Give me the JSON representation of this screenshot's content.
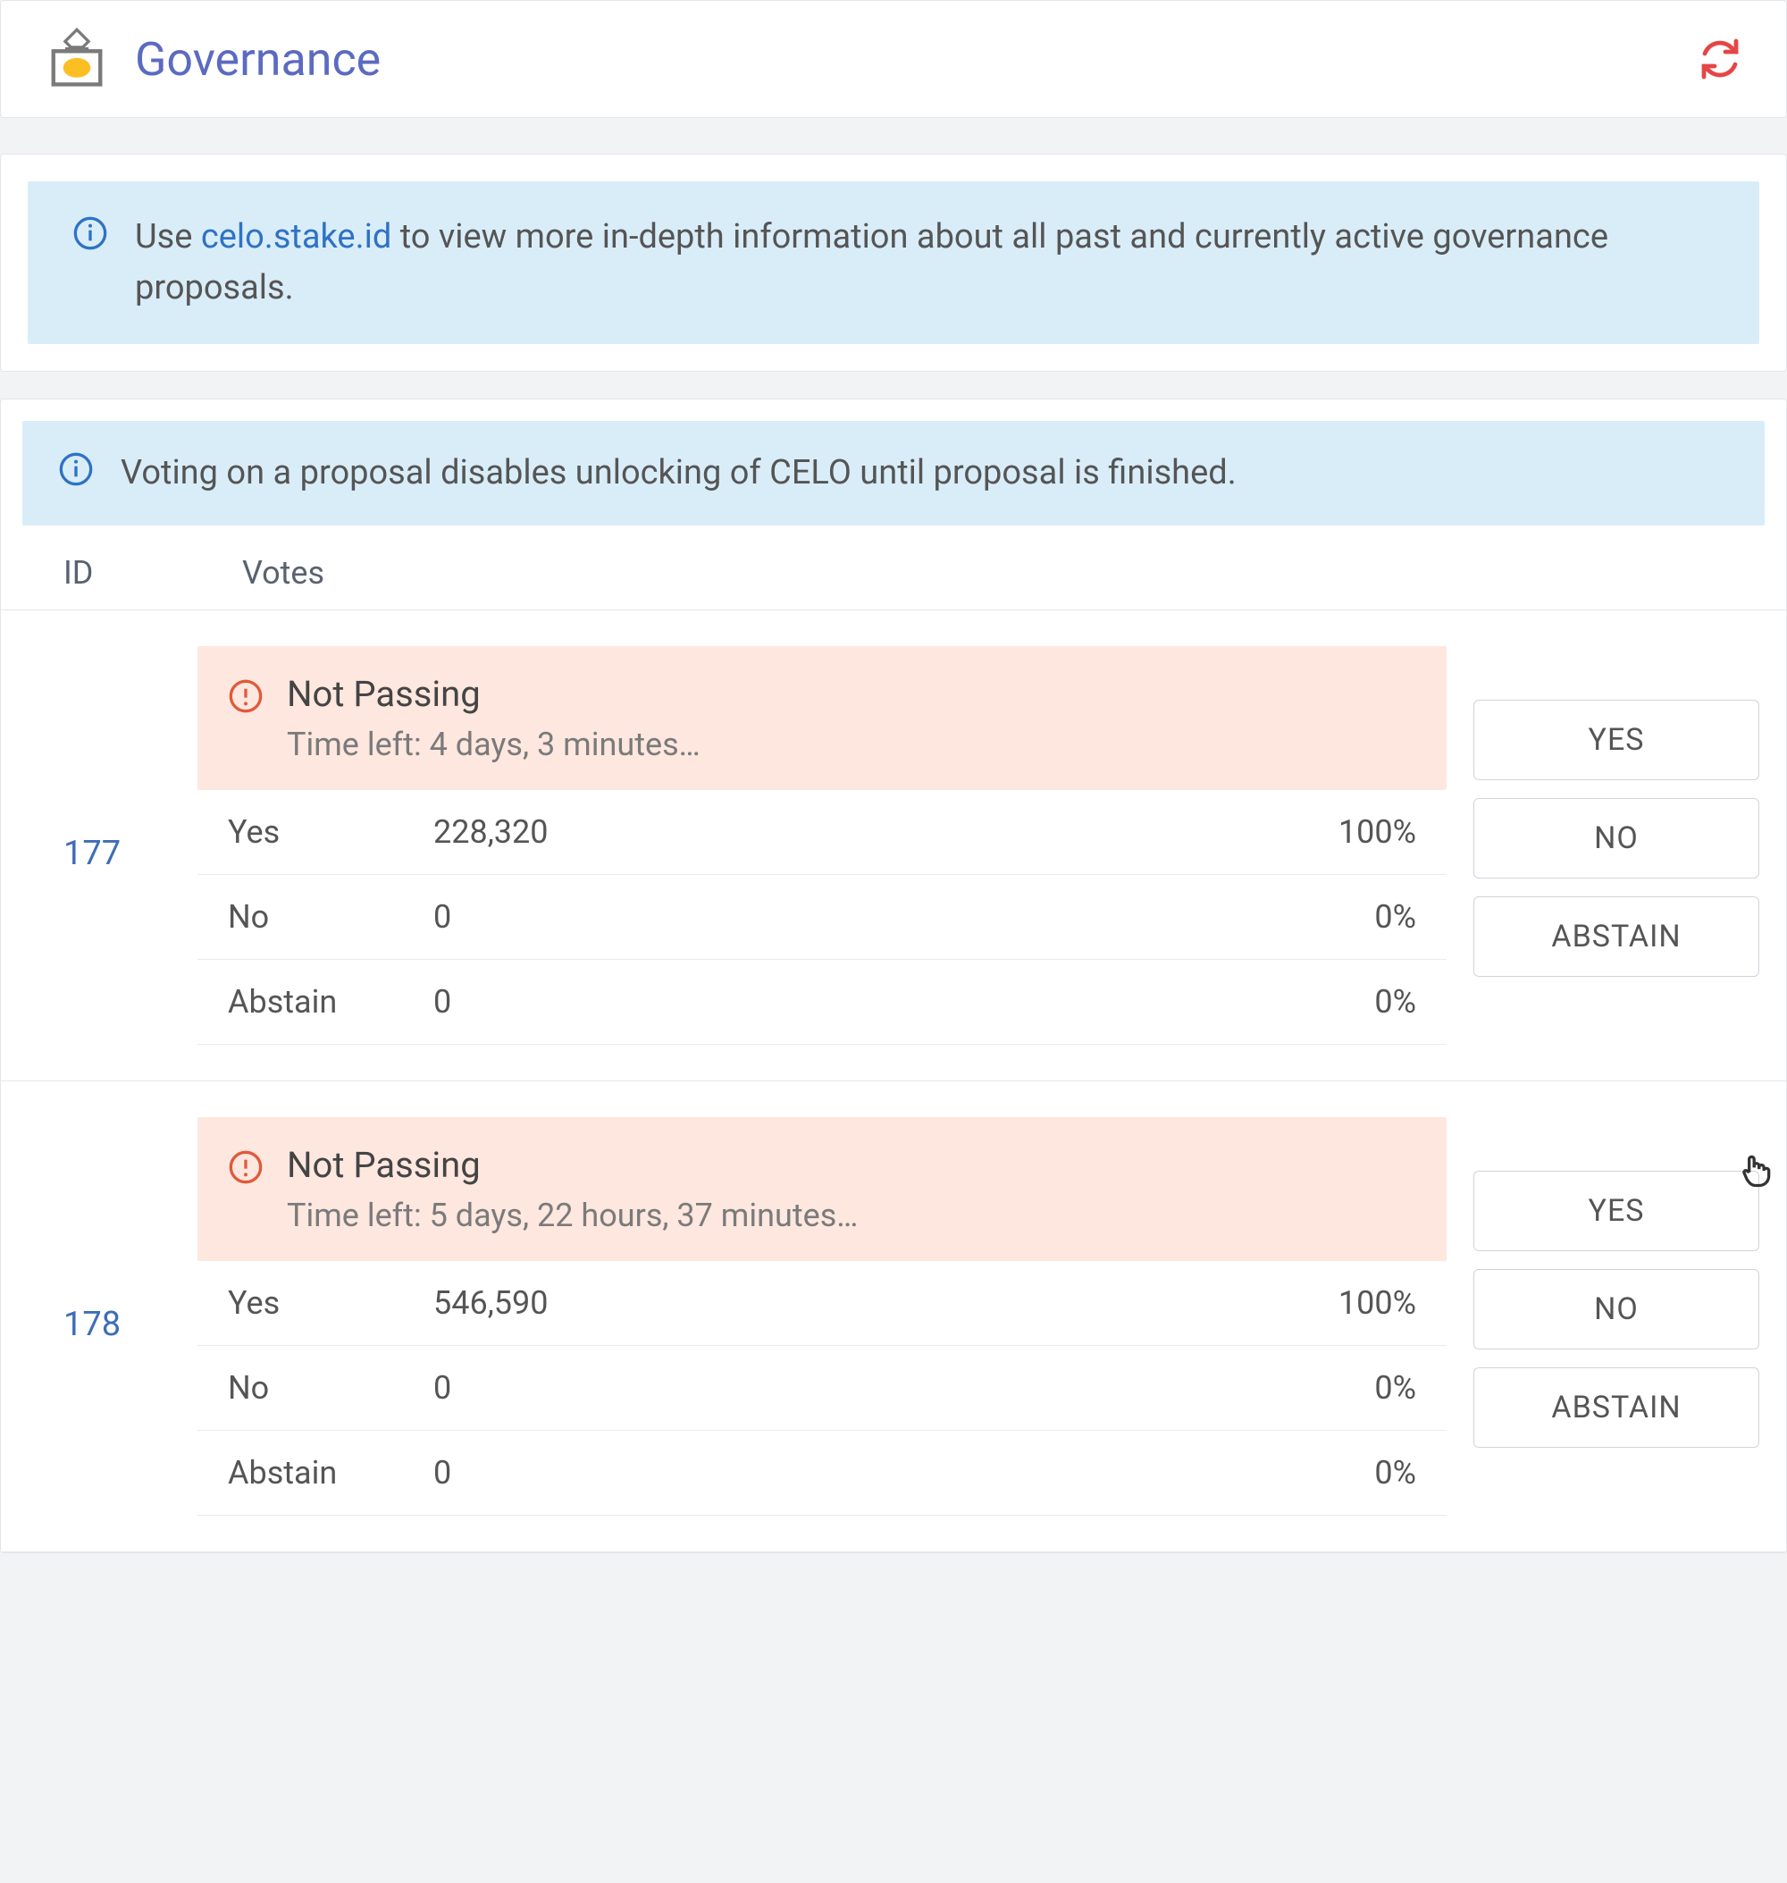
{
  "header": {
    "title": "Governance"
  },
  "banner1": {
    "prefix": "Use ",
    "link_text": "celo.stake.id",
    "suffix": " to view more in-depth information about all past and currently active governance proposals."
  },
  "banner2": {
    "text": "Voting on a proposal disables unlocking of CELO until proposal is finished."
  },
  "table": {
    "col_id": "ID",
    "col_votes": "Votes"
  },
  "buttons": {
    "yes": "YES",
    "no": "NO",
    "abstain": "ABSTAIN"
  },
  "vote_labels": {
    "yes": "Yes",
    "no": "No",
    "abstain": "Abstain"
  },
  "proposals": [
    {
      "id": "177",
      "status_title": "Not Passing",
      "status_sub": "Time left: 4 days, 3 minutes…",
      "yes_count": "228,320",
      "yes_pct": "100%",
      "no_count": "0",
      "no_pct": "0%",
      "abstain_count": "0",
      "abstain_pct": "0%"
    },
    {
      "id": "178",
      "status_title": "Not Passing",
      "status_sub": "Time left: 5 days, 22 hours, 37 minutes…",
      "yes_count": "546,590",
      "yes_pct": "100%",
      "no_count": "0",
      "no_pct": "0%",
      "abstain_count": "0",
      "abstain_pct": "0%"
    }
  ]
}
